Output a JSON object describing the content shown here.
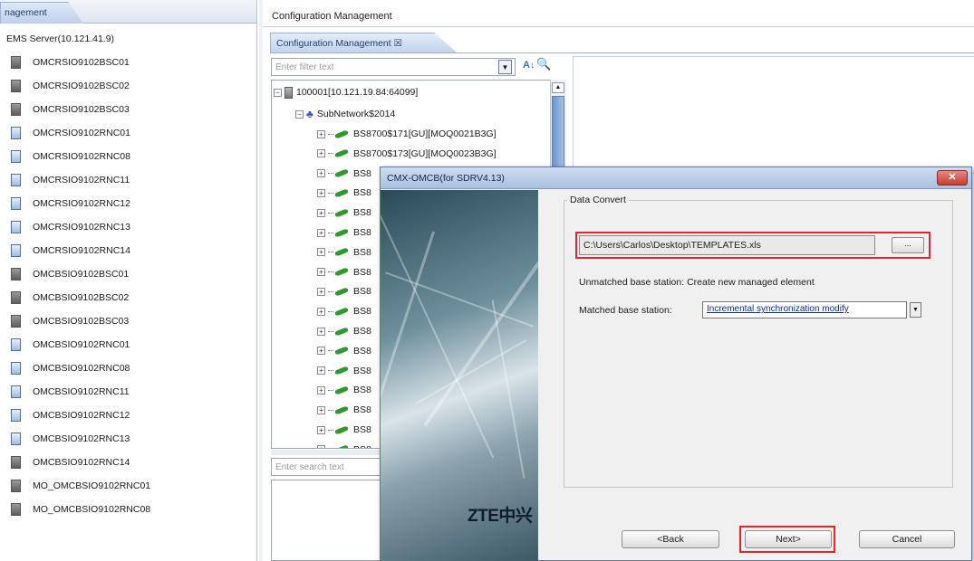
{
  "left_panel": {
    "tab_label": "nagement",
    "root_label": "EMS Server(10.121.41.9)",
    "items": [
      {
        "label": "OMCRSIO9102BSC01",
        "kind": "bsc"
      },
      {
        "label": "OMCRSIO9102BSC02",
        "kind": "bsc"
      },
      {
        "label": "OMCRSIO9102BSC03",
        "kind": "bsc"
      },
      {
        "label": "OMCRSIO9102RNC01",
        "kind": "rnc"
      },
      {
        "label": "OMCRSIO9102RNC08",
        "kind": "rnc"
      },
      {
        "label": "OMCRSIO9102RNC11",
        "kind": "rnc"
      },
      {
        "label": "OMCRSIO9102RNC12",
        "kind": "rnc"
      },
      {
        "label": "OMCRSIO9102RNC13",
        "kind": "rnc"
      },
      {
        "label": "OMCRSIO9102RNC14",
        "kind": "rnc"
      },
      {
        "label": "OMCBSIO9102BSC01",
        "kind": "bsc"
      },
      {
        "label": "OMCBSIO9102BSC02",
        "kind": "bsc"
      },
      {
        "label": "OMCBSIO9102BSC03",
        "kind": "bsc"
      },
      {
        "label": "OMCBSIO9102RNC01",
        "kind": "rnc"
      },
      {
        "label": "OMCBSIO9102RNC08",
        "kind": "rnc"
      },
      {
        "label": "OMCBSIO9102RNC11",
        "kind": "rnc"
      },
      {
        "label": "OMCBSIO9102RNC12",
        "kind": "rnc"
      },
      {
        "label": "OMCBSIO9102RNC13",
        "kind": "rnc"
      },
      {
        "label": "OMCBSIO9102RNC14",
        "kind": "bsc"
      },
      {
        "label": "MO_OMCBSIO9102RNC01",
        "kind": "bsc"
      },
      {
        "label": "MO_OMCBSIO9102RNC08",
        "kind": "bsc"
      }
    ]
  },
  "main": {
    "header_title": "Configuration Management",
    "tab_label": "Configuration Management ☒",
    "filter_placeholder": "Enter filter text",
    "search_placeholder": "Enter search text",
    "tree": {
      "root": "100001[10.121.19.84:64099]",
      "subnetwork": "SubNetwork$2014",
      "nodes": [
        "BS8700$171[GU][MOQ0021B3G]",
        "BS8700$173[GU][MOQ0023B3G]",
        "BS8",
        "BS8",
        "BS8",
        "BS8",
        "BS8",
        "BS8",
        "BS8",
        "BS8",
        "BS8",
        "BS8",
        "BS8",
        "BS8",
        "BS8",
        "BS8",
        "BS8"
      ]
    }
  },
  "dialog": {
    "title": "CMX-OMCB(for SDRV4.13)",
    "close_label": "✕",
    "brand": "ZTE中兴",
    "group_title": "Data Convert",
    "file_path": "C:\\Users\\Carlos\\Desktop\\TEMPLATES.xls",
    "browse_label": "...",
    "unmatched_text": "Unmatched base station:  Create new managed element",
    "matched_label": "Matched base station:",
    "matched_value": "Incremental synchronization modify",
    "back_label": "<Back",
    "next_label": "Next>",
    "cancel_label": "Cancel",
    "highlight_color": "#e0252b"
  }
}
